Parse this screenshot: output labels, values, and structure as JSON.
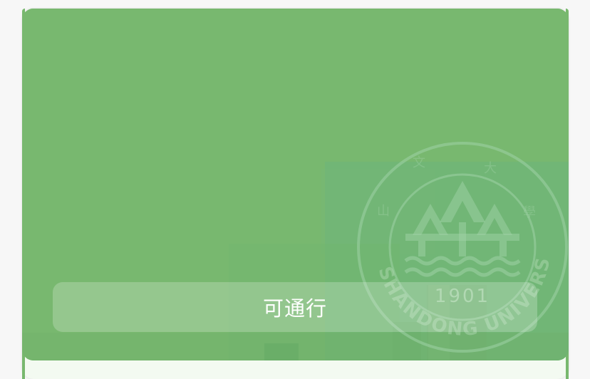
{
  "status_card": {
    "status_text": "可通行",
    "status_color": "#78b86f",
    "background_image": "campus-gate-photo",
    "emblem": {
      "icon": "university-seal-icon",
      "arc_text": "SHANDONG UNIVERSITY",
      "year": "1901"
    }
  }
}
